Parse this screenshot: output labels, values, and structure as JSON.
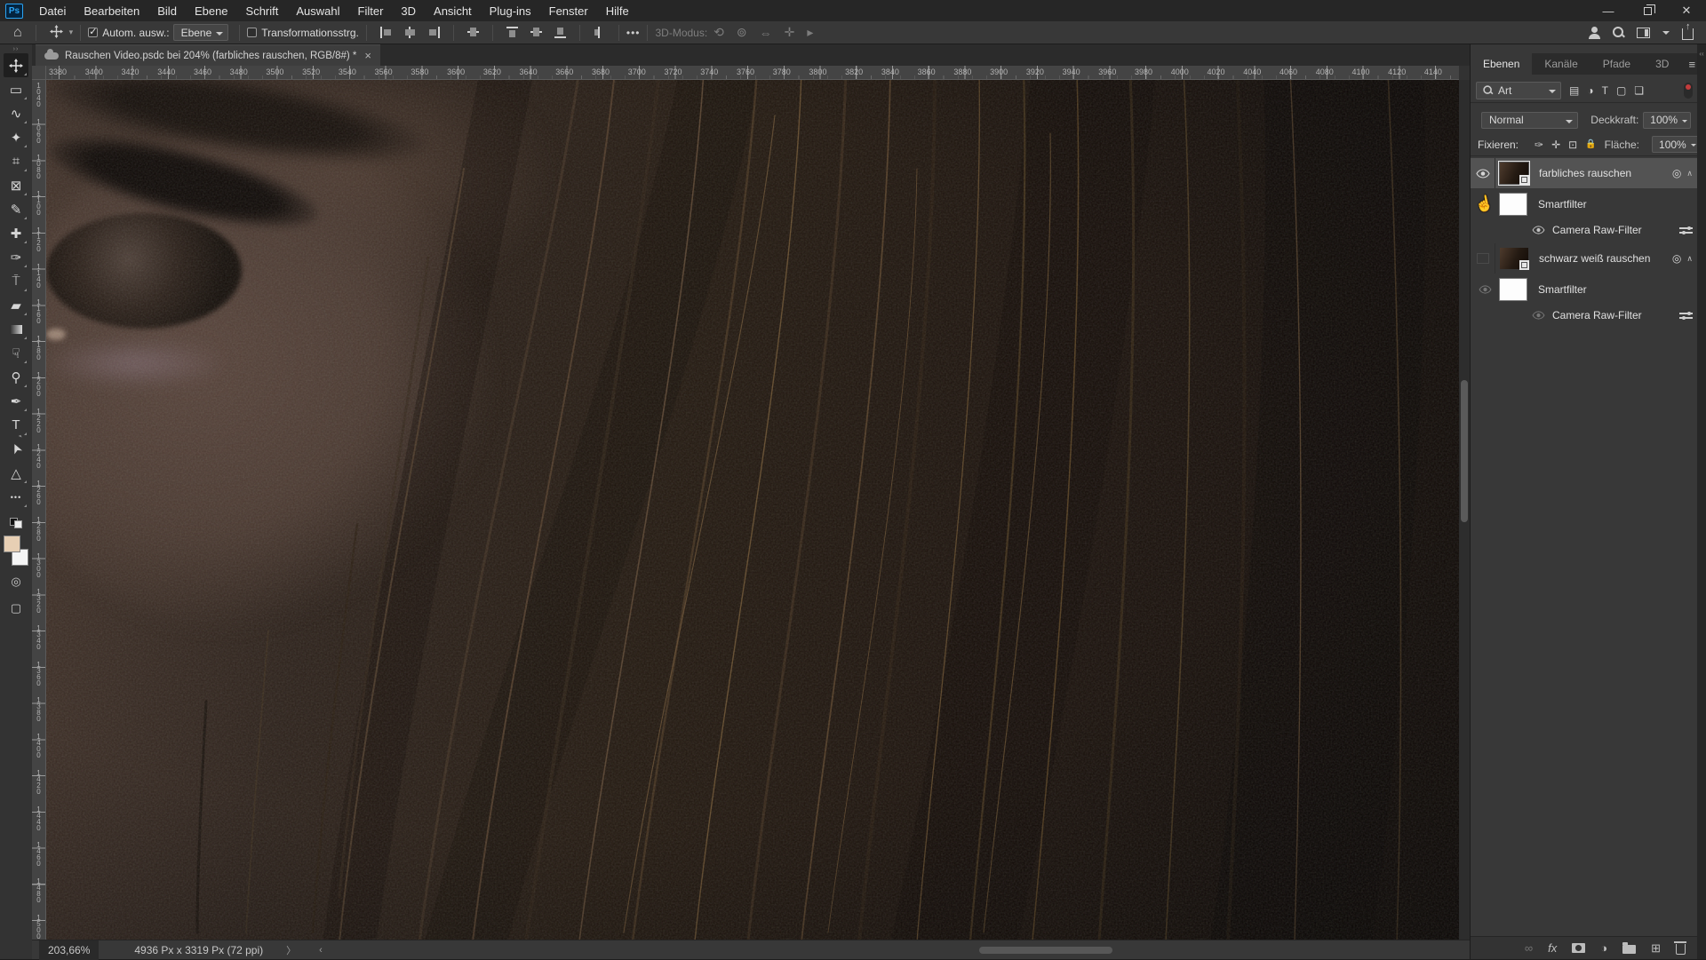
{
  "menu_bar": {
    "items": [
      "Datei",
      "Bearbeiten",
      "Bild",
      "Ebene",
      "Schrift",
      "Auswahl",
      "Filter",
      "3D",
      "Ansicht",
      "Plug-ins",
      "Fenster",
      "Hilfe"
    ]
  },
  "window": {
    "ps_logo": "Ps",
    "minimize": "—",
    "close": "✕"
  },
  "options_bar": {
    "auto_select_label": "Autom. ausw.:",
    "auto_select_value": "Ebene",
    "transform_label": "Transformationsstrg.",
    "more": "•••",
    "mode_label": "3D-Modus:"
  },
  "document_tab": {
    "title": "Rauschen Video.psdc bei 204% (farbliches rauschen, RGB/8#) *",
    "close": "×"
  },
  "rulers": {
    "h_labels": [
      "3380",
      "3400",
      "3420",
      "3440",
      "3460",
      "3480",
      "3500",
      "3520",
      "3540",
      "3560",
      "3580",
      "3600",
      "3620",
      "3640",
      "3660",
      "3680",
      "3700",
      "3720",
      "3740",
      "3760",
      "3780",
      "3800",
      "3820",
      "3840",
      "3860",
      "3880",
      "3900",
      "3920",
      "3940",
      "3960",
      "3980",
      "4000",
      "4020",
      "4040",
      "4060",
      "4080",
      "4100",
      "4120",
      "4140"
    ],
    "v_labels": [
      "1040",
      "1060",
      "1080",
      "1100",
      "1120",
      "1140",
      "1160",
      "1180",
      "1200",
      "1220",
      "1240",
      "1260",
      "1280",
      "1300",
      "1320",
      "1340",
      "1360",
      "1380",
      "1400",
      "1420",
      "1440",
      "1460",
      "1480",
      "1500"
    ]
  },
  "toolbar": {
    "collapse": "››",
    "tools": [
      "move",
      "marquee",
      "lasso",
      "quick-select",
      "crop",
      "frame",
      "eyedropper",
      "healing",
      "brush",
      "stamp",
      "eraser",
      "gradient",
      "smudge",
      "dodge",
      "pen",
      "type",
      "path-select",
      "shape",
      "more"
    ]
  },
  "icons": {
    "home": "⌂",
    "marquee": "▭",
    "lasso": "∿",
    "quick_select": "✦",
    "crop": "⌗",
    "frame": "⊠",
    "eyedropper": "✎",
    "healing": "✚",
    "brush": "✑",
    "stamp": "⍑",
    "eraser": "▰",
    "smudge": "☟",
    "dodge": "⚲",
    "pen": "✒",
    "type": "T",
    "path_select": "➤",
    "shape": "△",
    "more_dots": "•••",
    "quick_mask": "◎",
    "screen_mode": "▢",
    "threeD_1": "⟲",
    "threeD_2": "⊚",
    "threeD_3": "⇔",
    "threeD_4": "✛",
    "threeD_5": "▸",
    "hamburger": "≡",
    "adjustment": "◑",
    "image_filter": "▤",
    "type_filter": "T",
    "shape_filter": "▢",
    "smart_filter": "❏",
    "link": "∞",
    "fx": "fx",
    "new_layer": "⊞",
    "brush_lock": "✑",
    "move_lock": "✛",
    "artboard_lock": "⊡",
    "lock": "🔒",
    "hand_cursor": "☝",
    "sf_badge": "◎",
    "chevron_up": "∧",
    "status_next": "〉",
    "status_prev": "‹"
  },
  "layers_panel": {
    "tabs": [
      "Ebenen",
      "Kanäle",
      "Pfade",
      "3D"
    ],
    "filter_search_label": "Art",
    "blend_mode": "Normal",
    "opacity_label": "Deckkraft:",
    "opacity_value": "100%",
    "lock_label": "Fixieren:",
    "fill_label": "Fläche:",
    "fill_value": "100%",
    "layers": [
      {
        "name": "farbliches rauschen",
        "selected": true,
        "visible": true,
        "filters": [
          {
            "mask_label": "Smartfilter"
          },
          {
            "name": "Camera Raw-Filter"
          }
        ]
      },
      {
        "name": "schwarz weiß rauschen",
        "selected": false,
        "visible": false,
        "filters": [
          {
            "mask_label": "Smartfilter"
          },
          {
            "name": "Camera Raw-Filter"
          }
        ]
      }
    ]
  },
  "status_bar": {
    "zoom": "203,66%",
    "dimensions": "4936 Px x 3319 Px (72 ppi)"
  }
}
